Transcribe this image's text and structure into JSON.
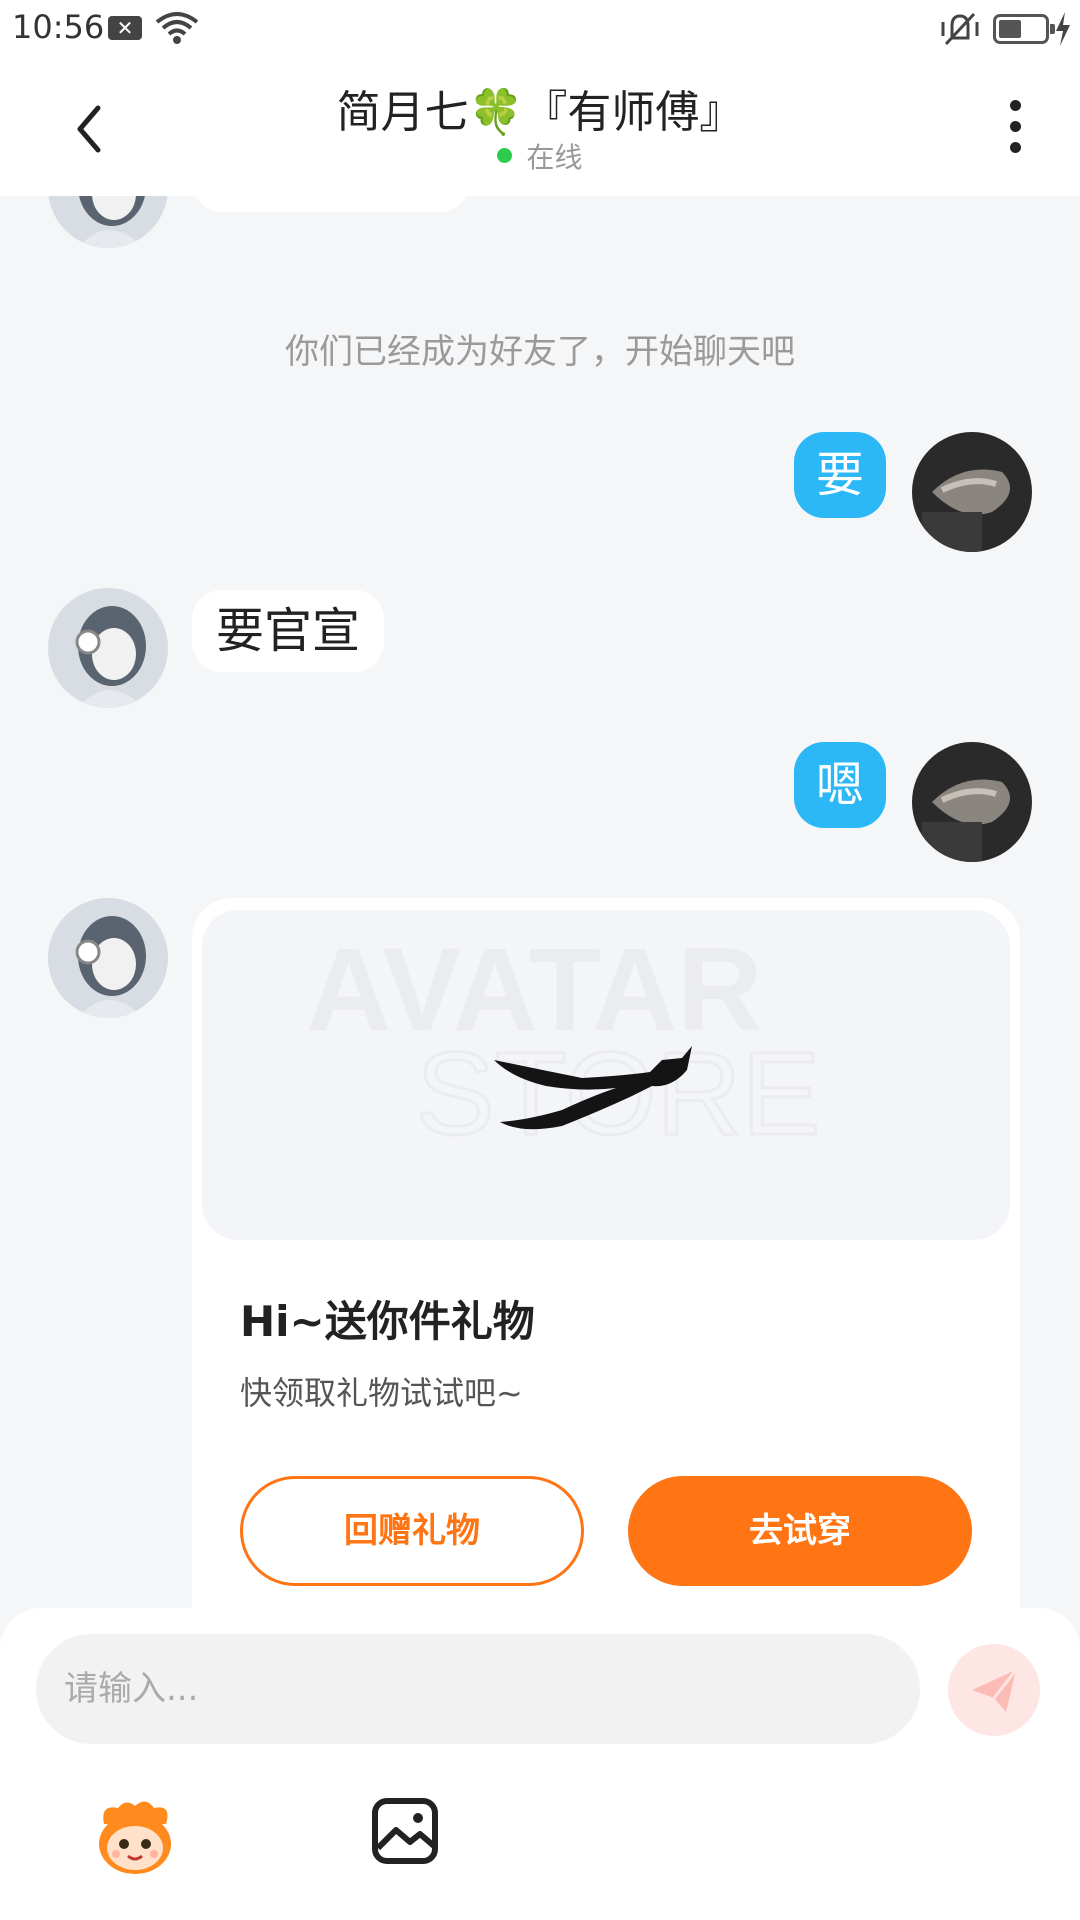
{
  "status_bar": {
    "time": "10:56",
    "notification_badge": "✕"
  },
  "header": {
    "title": "简月七🍀『有师傅』",
    "status": "在线"
  },
  "chat": {
    "system_message": "你们已经成为好友了，开始聊天吧",
    "messages": [
      {
        "side": "right",
        "text": "要"
      },
      {
        "side": "left",
        "text": "要官宣"
      },
      {
        "side": "right",
        "text": "嗯"
      }
    ],
    "gift_card": {
      "watermark_line1": "AVATAR",
      "watermark_line2": "STORE",
      "title": "Hi~送你件礼物",
      "subtitle": "快领取礼物试试吧~",
      "return_gift_label": "回赠礼物",
      "try_on_label": "去试穿"
    }
  },
  "input": {
    "placeholder": "请输入..."
  },
  "colors": {
    "accent": "#ff7413",
    "bubble_blue": "#2cb8f6",
    "online": "#2bcb4b"
  }
}
